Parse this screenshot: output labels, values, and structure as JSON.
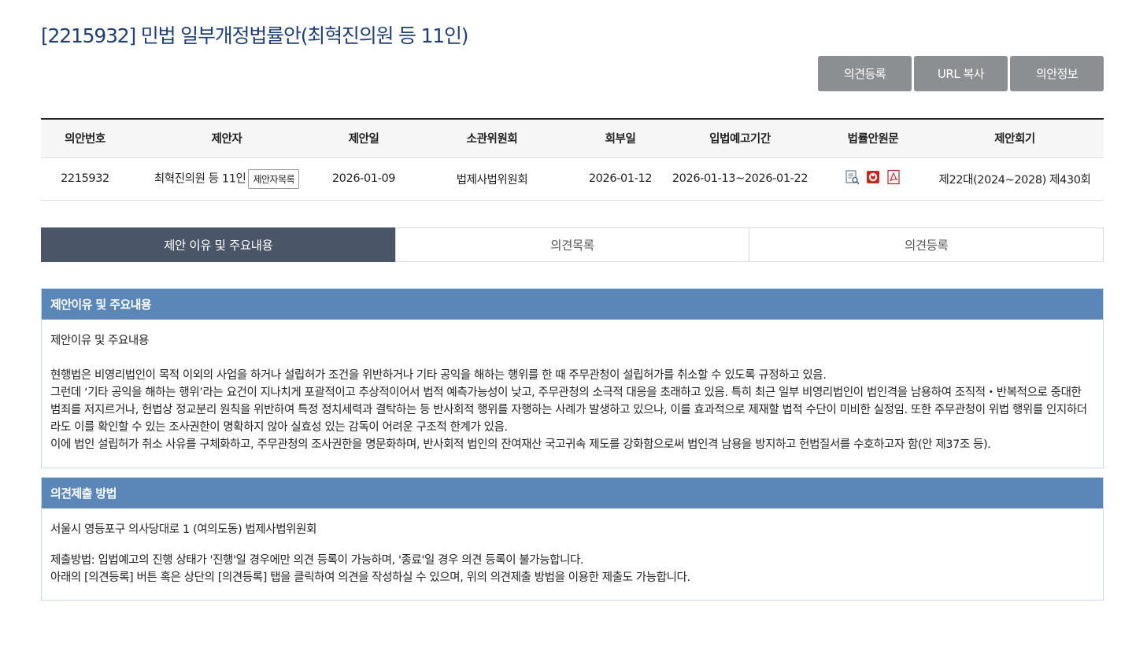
{
  "title": "[2215932] 민법 일부개정법률안(최혁진의원 등 11인)",
  "actions": {
    "register": "의견등록",
    "copy_url": "URL 복사",
    "bill_info": "의안정보"
  },
  "table": {
    "headers": [
      "의안번호",
      "제안자",
      "제안일",
      "소관위원회",
      "회부일",
      "입법예고기간",
      "법률안원문",
      "제안회기"
    ],
    "row": {
      "bill_no": "2215932",
      "proposer": "최혁진의원 등 11인",
      "proposer_list_btn": "제안자목록",
      "proposal_date": "2026-01-09",
      "committee": "법제사법위원회",
      "referral_date": "2026-01-12",
      "notice_period": "2026-01-13~2026-01-22",
      "session": "제22대(2024~2028) 제430회"
    }
  },
  "tabs": [
    "제안 이유 및 주요내용",
    "의견목록",
    "의견등록"
  ],
  "reason": {
    "header": "제안이유 및 주요내용",
    "subtitle": "제안이유 및 주요내용",
    "para1": "현행법은 비영리법인이 목적 이외의 사업을 하거나 설립허가 조건을 위반하거나 기타 공익을 해하는 행위를 한 때 주무관청이 설립허가를 취소할 수 있도록 규정하고 있음.",
    "para2": "그런데 ‘기타 공익을 해하는 행위’라는 요건이 지나치게 포괄적이고 추상적이어서 법적 예측가능성이 낮고, 주무관청의 소극적 대응을 초래하고 있음. 특히 최근 일부 비영리법인이 법인격을 남용하여 조직적・반복적으로 중대한 범죄를 저지르거나, 헌법상 정교분리 원칙을 위반하여 특정 정치세력과 결탁하는 등 반사회적 행위를 자행하는 사례가 발생하고 있으나, 이를 효과적으로 제재할 법적 수단이 미비한 실정임. 또한 주무관청이 위법 행위를 인지하더라도 이를 확인할 수 있는 조사권한이 명확하지 않아 실효성 있는 감독이 어려운 구조적 한계가 있음.",
    "para3": "이에 법인 설립허가 취소 사유를 구체화하고, 주무관청의 조사권한을 명문화하며, 반사회적 법인의 잔여재산 국고귀속 제도를 강화함으로써 법인격 남용을 방지하고 헌법질서를 수호하고자 함(안 제37조 등)."
  },
  "submit": {
    "header": "의견제출 방법",
    "address": "서울시 영등포구 의사당대로 1 (여의도동) 법제사법위원회",
    "line1": "제출방법: 입법예고의 진행 상태가 '진행'일 경우에만 의견 등록이 가능하며, '종료'일 경우 의견 등록이 불가능합니다.",
    "line2": "아래의 [의견등록] 버튼 혹은 상단의 [의견등록] 탭을 클릭하여 의견을 작성하실 수 있으며, 위의 의견제출 방법을 이용한 제출도 가능합니다."
  },
  "colors": {
    "title": "#1f3f78",
    "gray_button": "#8c8f91",
    "active_tab": "#4a5568",
    "section_header": "#5a87b8"
  },
  "icons": [
    "document-search-icon",
    "hwp-file-icon",
    "pdf-file-icon"
  ]
}
